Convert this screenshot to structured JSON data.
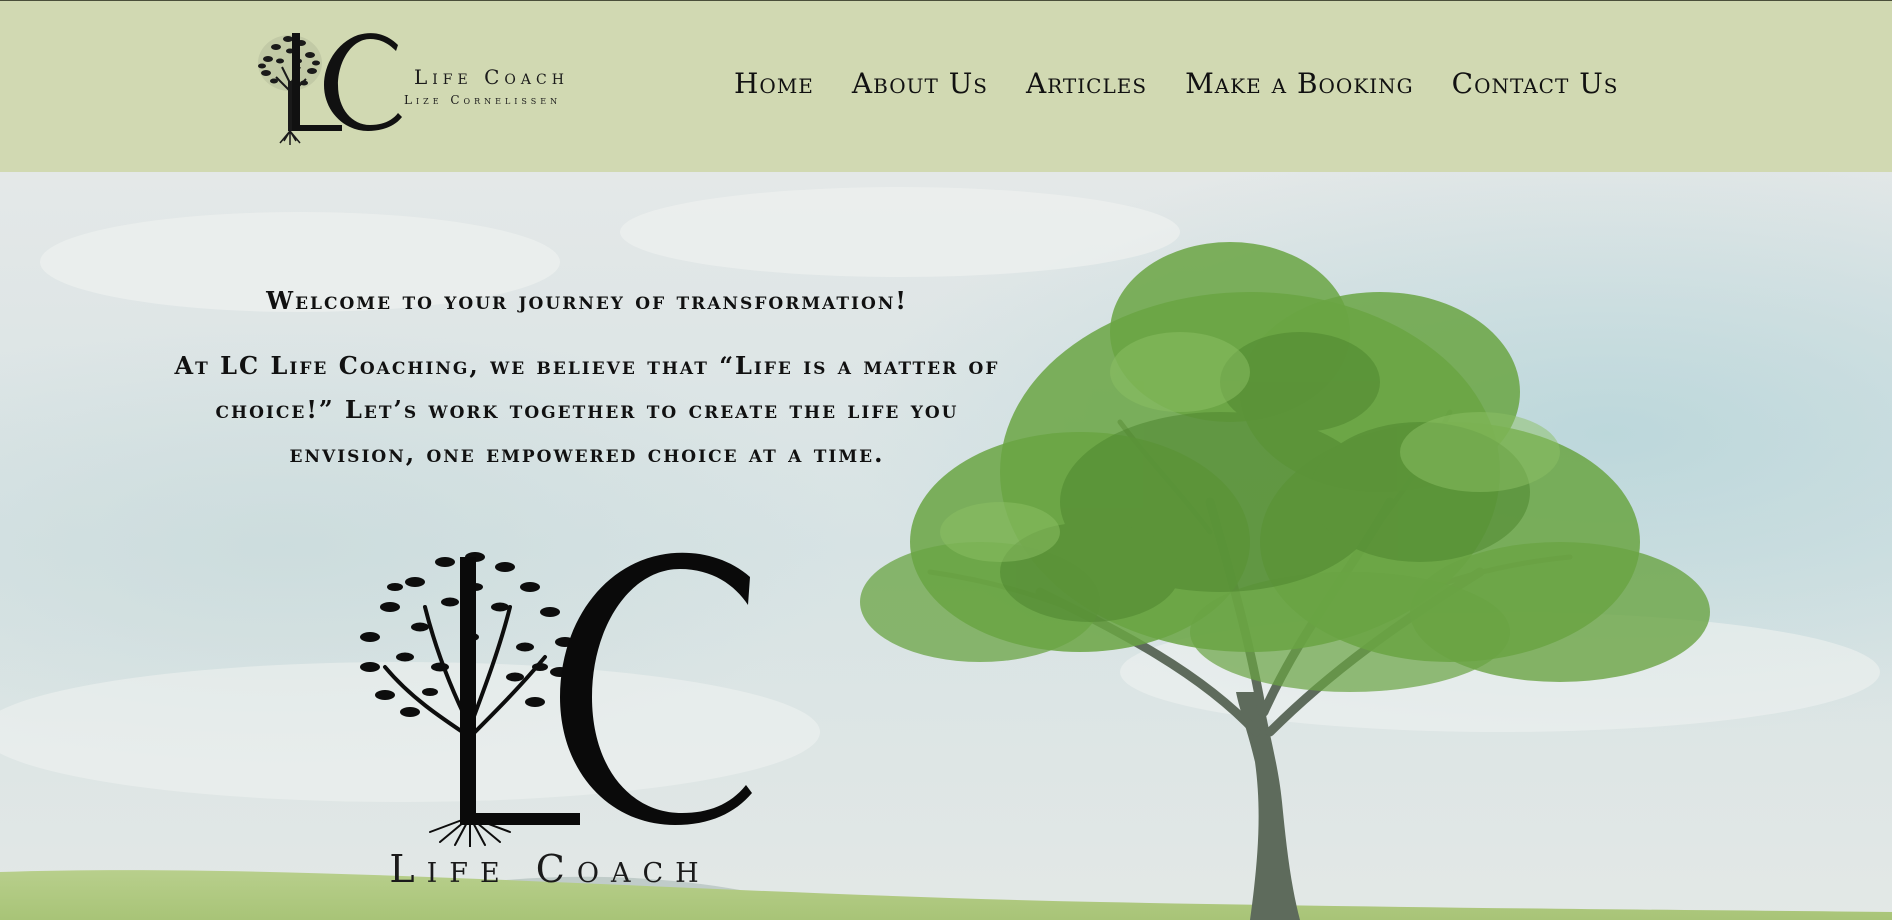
{
  "brand": {
    "title": "Life Coach",
    "subtitle": "Lize Cornelissen"
  },
  "nav": {
    "items": [
      "Home",
      "About Us",
      "Articles",
      "Make a Booking",
      "Contact Us"
    ]
  },
  "hero": {
    "welcome": "Welcome to your journey of transformation!",
    "body": "At LC Life Coaching, we believe that “Life is a matter of choice!” Let’s work together to create the life you envision, one empowered choice at a time.",
    "logo_title": "Life Coach"
  },
  "colors": {
    "header_bg": "#d1d9b2",
    "text": "#111111",
    "tree_green": "#5f9b3a"
  }
}
